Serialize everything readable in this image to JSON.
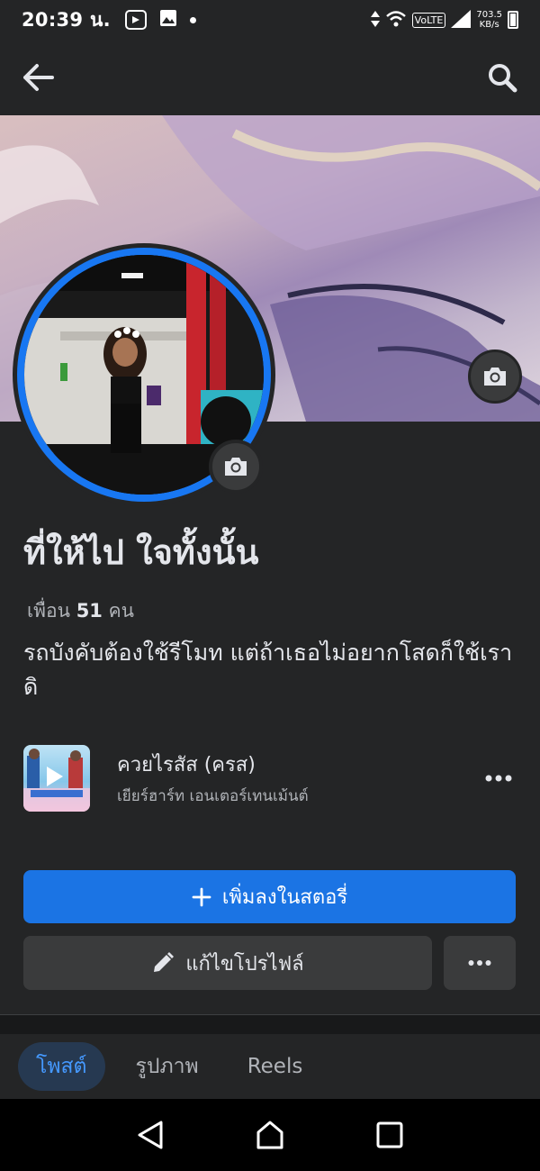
{
  "status_bar": {
    "time": "20:39 น.",
    "network": "VoLTE",
    "speed_value": "703.5",
    "speed_unit": "KB/s",
    "icons": [
      "message-icon",
      "image-icon",
      "dot-icon",
      "data-arrows-icon",
      "wifi-icon",
      "signal-icon",
      "battery-icon"
    ]
  },
  "header": {
    "back_icon": "arrow-left-icon",
    "search_icon": "search-icon"
  },
  "profile": {
    "name": "ที่ให้ไป ใจทั้งนั้น",
    "friends_prefix": "เพื่อน",
    "friends_count": "51",
    "friends_suffix": "คน",
    "bio": "รถบังคับต้องใช้รีโมท แต่ถ้าเธอไม่อยากโสดก็ใช้เราดิ",
    "cover_camera_icon": "camera-icon",
    "avatar_camera_icon": "camera-icon"
  },
  "music": {
    "title": "ควยไรสัส (ครส)",
    "artist": "เยียร์ฮาร์ท เอนเตอร์เทนเม้นต์",
    "more_icon": "more-dots-icon"
  },
  "actions": {
    "add_story": "เพิ่มลงในสตอรี่",
    "edit_profile": "แก้ไขโปรไฟล์",
    "more_icon": "more-dots-icon"
  },
  "tabs": [
    {
      "label": "โพสต์",
      "active": true
    },
    {
      "label": "รูปภาพ",
      "active": false
    },
    {
      "label": "Reels",
      "active": false
    }
  ],
  "nav": [
    "back-triangle-icon",
    "home-circle-icon",
    "recents-square-icon"
  ],
  "colors": {
    "background": "#242526",
    "accent": "#1b74e4",
    "secondary_button": "#3a3b3c",
    "active_tab_bg": "#263951",
    "active_tab_text": "#4599ff"
  }
}
